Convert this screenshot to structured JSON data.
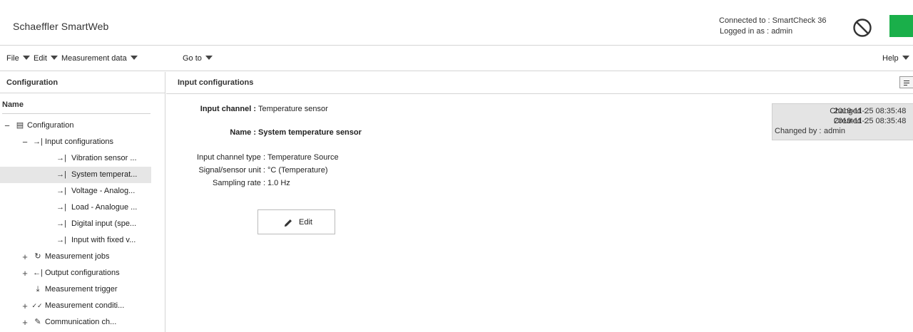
{
  "header": {
    "app_title": "Schaeffler SmartWeb",
    "connected_label": "Connected to :",
    "connected_value": "SmartCheck 36",
    "logged_label": "Logged in as :",
    "logged_value": "admin",
    "status_icon": "no-entry-icon",
    "status_color": "#1aaf4a"
  },
  "menu": {
    "file": "File",
    "edit": "Edit",
    "measurement_data": "Measurement data",
    "go_to": "Go to",
    "help": "Help"
  },
  "left": {
    "title": "Configuration",
    "column_header": "Name",
    "tree": [
      {
        "label": "Configuration",
        "expander": "−",
        "icon": "▤"
      },
      {
        "label": "Input configurations",
        "expander": "−",
        "icon": "→|"
      },
      {
        "label": "Vibration sensor ...",
        "expander": "",
        "icon": "→|"
      },
      {
        "label": "System temperat...",
        "expander": "",
        "icon": "→|"
      },
      {
        "label": "Voltage - Analog...",
        "expander": "",
        "icon": "→|"
      },
      {
        "label": "Load - Analogue ...",
        "expander": "",
        "icon": "→|"
      },
      {
        "label": "Digital input (spe...",
        "expander": "",
        "icon": "→|"
      },
      {
        "label": "Input with fixed v...",
        "expander": "",
        "icon": "→|"
      },
      {
        "label": "Measurement jobs",
        "expander": "+",
        "icon": "↻"
      },
      {
        "label": "Output configurations",
        "expander": "+",
        "icon": "←|"
      },
      {
        "label": "Measurement trigger",
        "expander": "",
        "icon": "⤓"
      },
      {
        "label": "Measurement conditi...",
        "expander": "+",
        "icon": "✓✓"
      },
      {
        "label": "Communication ch...",
        "expander": "+",
        "icon": "✎"
      }
    ]
  },
  "main": {
    "title": "Input configurations",
    "input_channel_label": "Input channel :",
    "input_channel_value": "Temperature sensor",
    "name_label": "Name :",
    "name_value": "System temperature sensor",
    "channel_type_label": "Input channel type :",
    "channel_type_value": "Temperature Source",
    "unit_label": "Signal/sensor unit :",
    "unit_value": "°C (Temperature)",
    "sampling_label": "Sampling rate :",
    "sampling_value": "1.0 Hz",
    "edit_button": "Edit",
    "changed_label": "Changed :",
    "changed_value": "2019-11-25 08:35:48",
    "created_label": "Created :",
    "created_value": "2019-11-25 08:35:48",
    "changed_by_label": "Changed by :",
    "changed_by_value": "admin"
  }
}
